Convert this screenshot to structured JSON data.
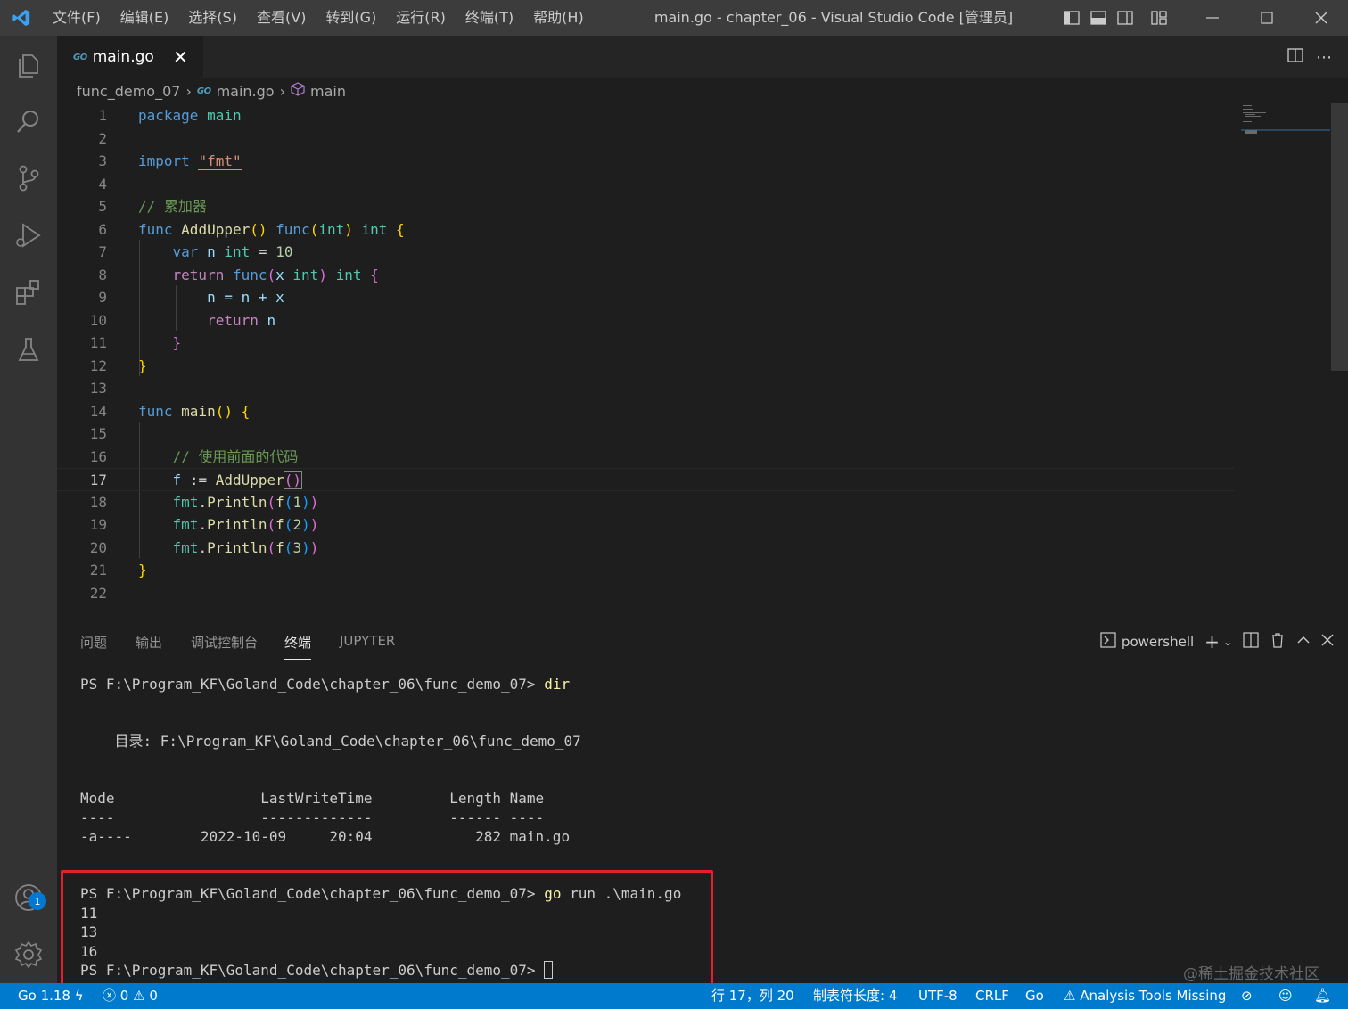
{
  "titlebar": {
    "menus": [
      "文件(F)",
      "编辑(E)",
      "选择(S)",
      "查看(V)",
      "转到(G)",
      "运行(R)",
      "终端(T)",
      "帮助(H)"
    ],
    "title": "main.go - chapter_06 - Visual Studio Code [管理员]"
  },
  "tab": {
    "icon_text": "GO",
    "label": "main.go"
  },
  "breadcrumb": {
    "folder": "func_demo_07",
    "file": "main.go",
    "symbol": "main"
  },
  "code": {
    "line_numbers": [
      "1",
      "2",
      "3",
      "4",
      "5",
      "6",
      "7",
      "8",
      "9",
      "10",
      "11",
      "12",
      "13",
      "14",
      "15",
      "16",
      "17",
      "18",
      "19",
      "20",
      "21",
      "22"
    ],
    "active_line": "17",
    "line1": {
      "kw": "package",
      "name": "main"
    },
    "line3": {
      "kw": "import",
      "str": "\"fmt\""
    },
    "line5": {
      "comment": "// 累加器"
    },
    "line6": {
      "func": "func",
      "name": "AddUpper",
      "func2": "func",
      "int1": "int",
      "int2": "int"
    },
    "line7": {
      "var": "var",
      "n": "n",
      "int": "int",
      "eq": "=",
      "num": "10"
    },
    "line8": {
      "ret": "return",
      "func": "func",
      "x": "x",
      "int1": "int",
      "int2": "int"
    },
    "line9": {
      "text": "n = n + x"
    },
    "line10": {
      "ret": "return",
      "n": "n"
    },
    "line14": {
      "func": "func",
      "name": "main"
    },
    "line16": {
      "comment": "// 使用前面的代码"
    },
    "line17": {
      "f": "f",
      "op": ":=",
      "call": "AddUpper"
    },
    "line18": {
      "pkg": "fmt",
      "fn": "Println",
      "arg": "1"
    },
    "line19": {
      "pkg": "fmt",
      "fn": "Println",
      "arg": "2"
    },
    "line20": {
      "pkg": "fmt",
      "fn": "Println",
      "arg": "3"
    }
  },
  "panel": {
    "tabs": [
      "问题",
      "输出",
      "调试控制台",
      "终端",
      "JUPYTER"
    ],
    "active_tab": "终端",
    "shell": "powershell"
  },
  "terminal": {
    "prompt": "PS F:\\Program_KF\\Goland_Code\\chapter_06\\func_demo_07>",
    "cmd1": "dir",
    "dir_line": "    目录: F:\\Program_KF\\Goland_Code\\chapter_06\\func_demo_07",
    "header": "Mode                 LastWriteTime         Length Name",
    "dashes": "----                 -------------         ------ ----",
    "row": "-a----        2022-10-09     20:04            282 main.go",
    "cmd2_go": "go",
    "cmd2_rest": "run .\\main.go",
    "outputs": [
      "11",
      "13",
      "16"
    ]
  },
  "status": {
    "go_version": "Go 1.18",
    "errors": "0",
    "warnings": "0",
    "position": "行 17，列 20",
    "tab_size": "制表符长度: 4",
    "encoding": "UTF-8",
    "eol": "CRLF",
    "language": "Go",
    "analysis": "Analysis Tools Missing"
  },
  "accounts_badge": "1",
  "watermark": "@稀土掘金技术社区",
  "colors": {
    "accent": "#007acc",
    "highlight_box": "#e5202a"
  }
}
